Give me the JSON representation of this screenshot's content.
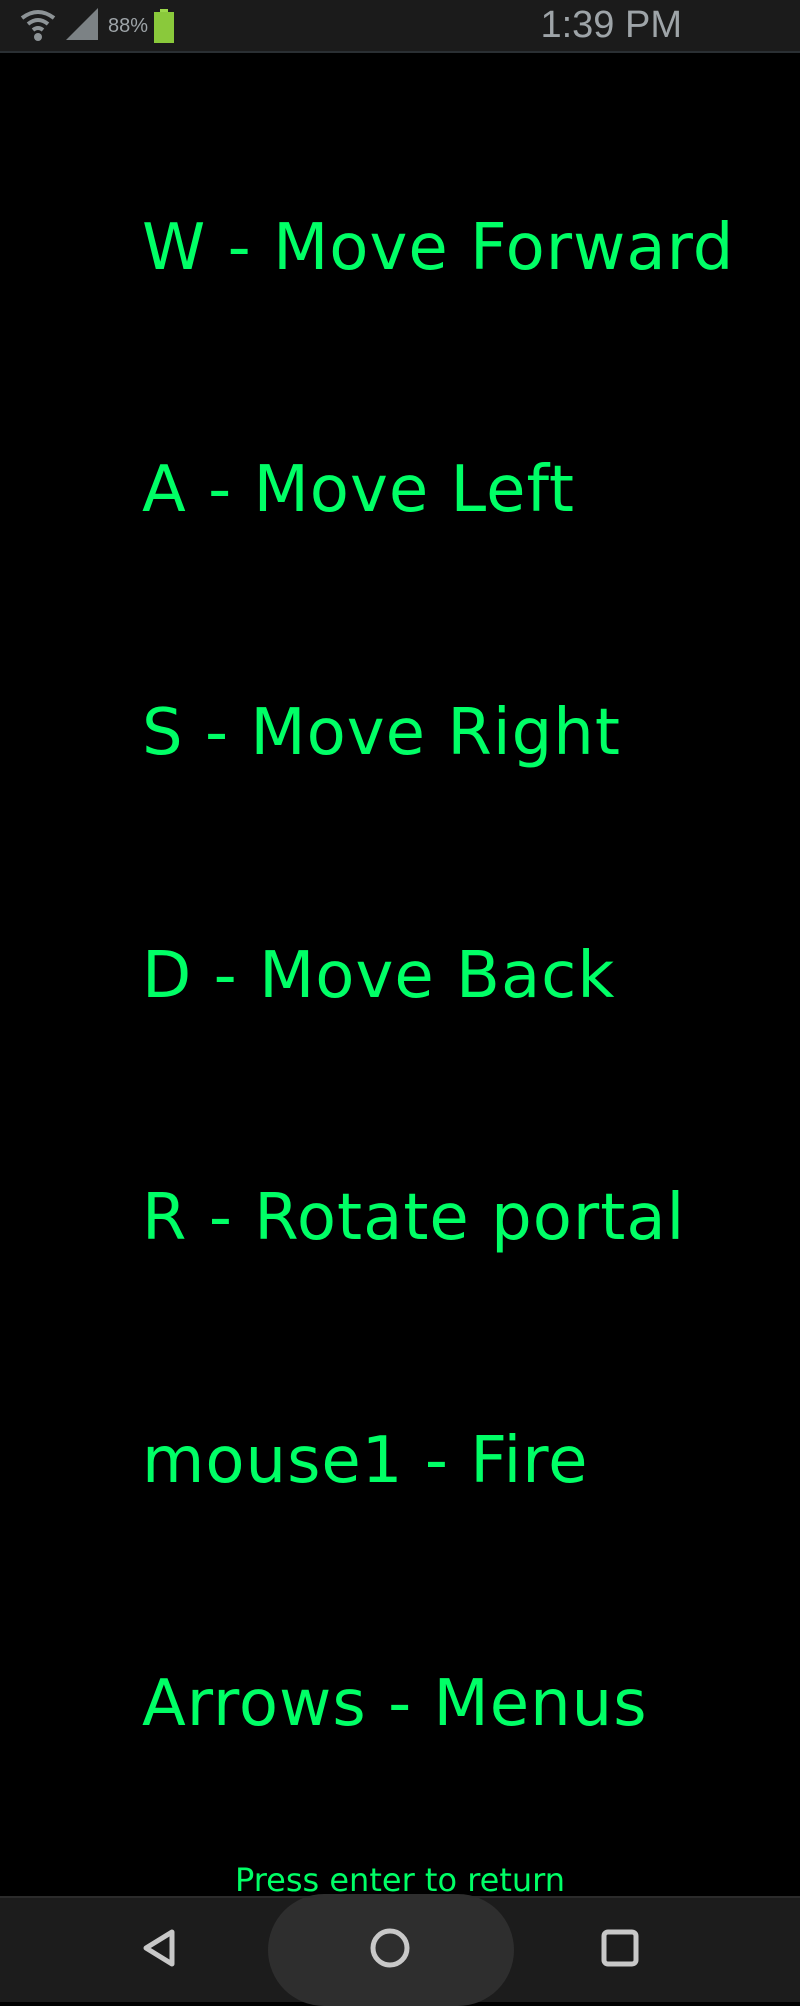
{
  "status_bar": {
    "wifi_icon": "wifi-icon",
    "signal_icon": "cell-signal-icon",
    "battery_percent": "88%",
    "battery_icon": "battery-icon",
    "battery_color": "#8ac93b",
    "time": "1:39 PM"
  },
  "controls": [
    {
      "label": "W - Move Forward"
    },
    {
      "label": "A - Move Left"
    },
    {
      "label": "S - Move Right"
    },
    {
      "label": "D - Move Back"
    },
    {
      "label": "R - Rotate portal"
    },
    {
      "label": "mouse1 - Fire"
    },
    {
      "label": "Arrows - Menus"
    }
  ],
  "footer": {
    "hint": "Press enter to return"
  },
  "nav_bar": {
    "back_icon": "back-triangle-icon",
    "home_icon": "home-circle-icon",
    "recents_icon": "recents-square-icon"
  },
  "colors": {
    "background": "#000000",
    "text_green": "#00ff66",
    "status_bar_bg": "#1b1b1b",
    "nav_bar_bg": "#1c1c1c"
  }
}
